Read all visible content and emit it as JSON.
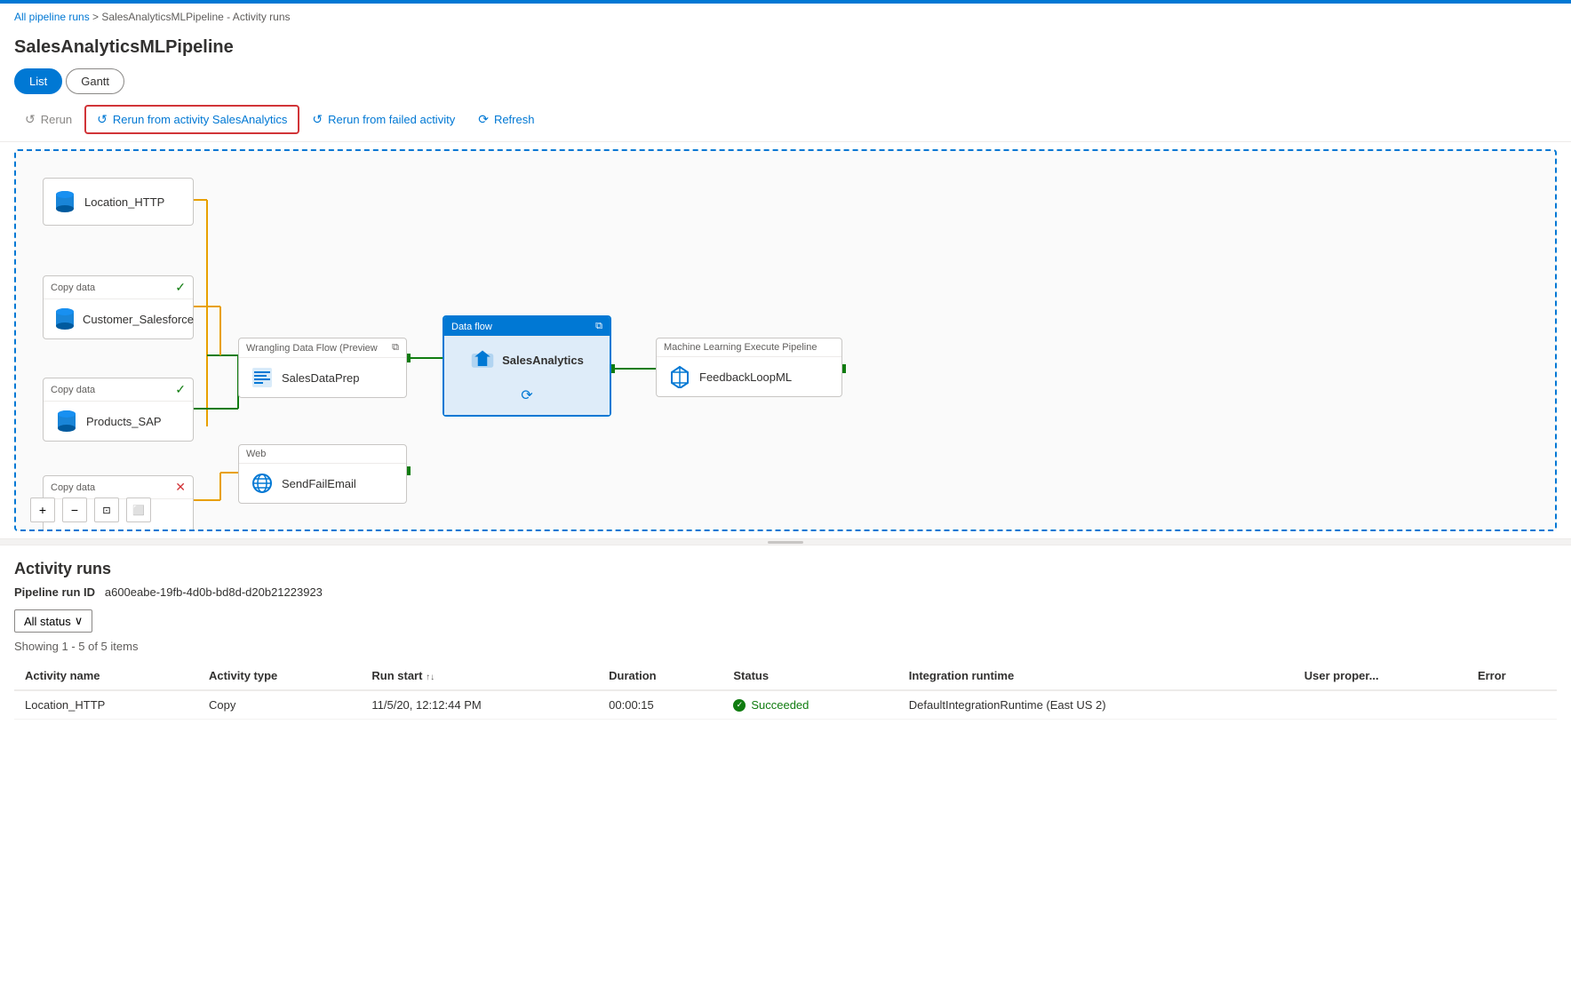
{
  "topbar": {
    "color": "#0078d4"
  },
  "breadcrumb": {
    "part1": "All pipeline runs",
    "separator": " > ",
    "part2": "SalesAnalyticsMLPipeline - Activity runs"
  },
  "page": {
    "title": "SalesAnalyticsMLPipeline"
  },
  "tabs": [
    {
      "id": "list",
      "label": "List",
      "active": true
    },
    {
      "id": "gantt",
      "label": "Gantt",
      "active": false
    }
  ],
  "toolbar": {
    "rerun_label": "Rerun",
    "rerun_activity_label": "Rerun from activity SalesAnalytics",
    "rerun_failed_label": "Rerun from failed activity",
    "refresh_label": "Refresh"
  },
  "nodes": {
    "location": {
      "label": "Location_HTTP",
      "type": null
    },
    "customer": {
      "header": "Copy data",
      "label": "Customer_Salesforce",
      "status": "success"
    },
    "products": {
      "header": "Copy data",
      "label": "Products_SAP",
      "status": "success"
    },
    "copydata3": {
      "header": "Copy data",
      "label": "",
      "status": "error"
    },
    "salesdata": {
      "header": "Wrangling Data Flow (Preview",
      "label": "SalesDataPrep"
    },
    "sendfail": {
      "header": "Web",
      "label": "SendFailEmail"
    },
    "salesanalytics": {
      "header": "Data flow",
      "label": "SalesAnalytics",
      "selected": true
    },
    "feedbackloop": {
      "header": "Machine Learning Execute Pipeline",
      "label": "FeedbackLoopML"
    }
  },
  "canvas_footer": {
    "zoom_in": "+",
    "zoom_out": "−",
    "fit": "⊡",
    "select": "⬜"
  },
  "activity_section": {
    "title": "Activity runs",
    "run_id_label": "Pipeline run ID",
    "run_id_value": "a600eabe-19fb-4d0b-bd8d-d20b21223923",
    "filter_label": "All status",
    "showing_text": "Showing 1 - 5 of 5 items",
    "columns": [
      "Activity name",
      "Activity type",
      "Run start",
      "Duration",
      "Status",
      "Integration runtime",
      "User proper...",
      "Error"
    ],
    "rows": [
      {
        "activity_name": "Location_HTTP",
        "activity_type": "Copy",
        "run_start": "11/5/20, 12:12:44 PM",
        "duration": "00:00:15",
        "status": "Succeeded",
        "integration_runtime": "DefaultIntegrationRuntime (East US 2)",
        "user_properties": "",
        "error": ""
      }
    ]
  }
}
